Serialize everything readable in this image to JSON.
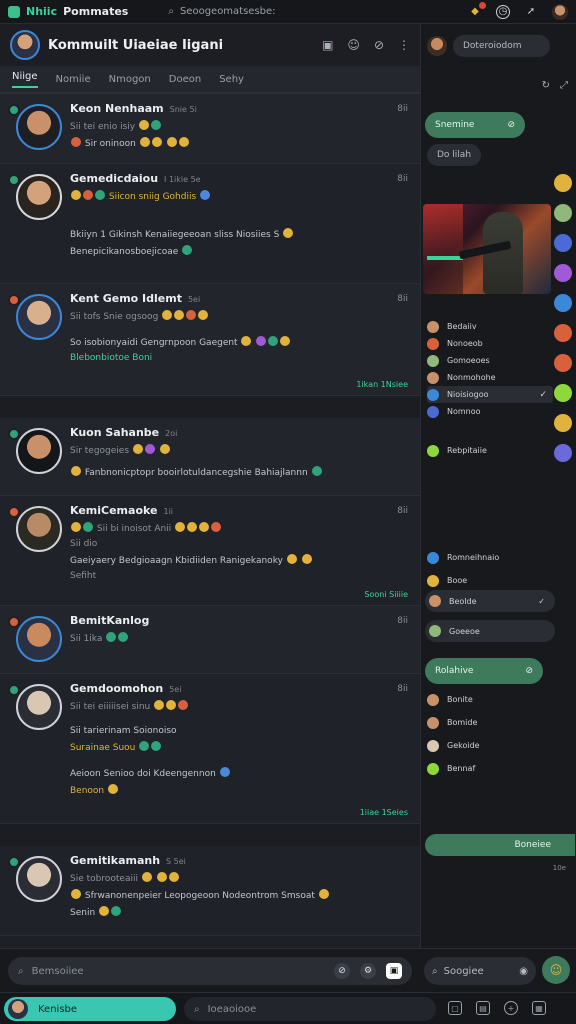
{
  "topbar": {
    "brand_a": "Nhiic",
    "brand_b": "Pommates",
    "search_placeholder": "Seoogeomatsesbe:"
  },
  "channel": {
    "title": "Kommuilt Uiaeiae Iigani",
    "tabs": [
      "Niige",
      "Nomiie",
      "Nmogon",
      "Doeon",
      "Sehy"
    ]
  },
  "messages": [
    {
      "name": "Keon Nenhaam",
      "meta": "Snie 5i",
      "more": "8ii",
      "lines": [
        "Sii tei enio isiy",
        "Sir oninoon"
      ],
      "timestamp": ""
    },
    {
      "name": "Gemedicdaiou",
      "meta": "I 1ikie 5e",
      "more": "8ii",
      "lines": [
        "Siicon sniig Gohdiis",
        "Bkiiyn 1 Gikinsh Kenaiiegeeoan sliss Niosiies S",
        "Benepicikanosboejicoae"
      ],
      "timestamp": ""
    },
    {
      "name": "Kent Gemo Idlemt",
      "meta": "5ei",
      "more": "8ii",
      "lines": [
        "Sii tofs Snie ogsoog",
        "So isobionyaidi Gengrnpoon Gaegent",
        "Blebonbiotoe Boni"
      ],
      "timestamp": "1ikan 1Nsiee"
    },
    {
      "name": "Kuon Sahanbe",
      "meta": "2oi",
      "more": "",
      "lines": [
        "Sir tegogeies",
        "Fanbnonicptopr booirlotuldancegshie Bahiajlannn"
      ],
      "timestamp": ""
    },
    {
      "name": "KemiCemaoke",
      "meta": "1ii",
      "more": "8ii",
      "lines": [
        "Sii bi inoisot Anii",
        "Sii dio",
        "Gaeiyaery Bedgioaagn Kbidiiden Ranigekanoky",
        "Sefiht"
      ],
      "timestamp": "Sooni Siiiie"
    },
    {
      "name": "BemitKanlog",
      "meta": "",
      "more": "8ii",
      "lines": [
        "Sii 1ika"
      ],
      "timestamp": ""
    },
    {
      "name": "Gemdoomohon",
      "meta": "5ei",
      "more": "8ii",
      "lines": [
        "Sii tei eiiiiisei sinu",
        "Sii tarierinam Soionoiso",
        "Surainae Suou",
        "Aeioon Senioo doi Kdeengennon",
        "Benoon"
      ],
      "timestamp": "1iiae 1Seies"
    },
    {
      "name": "Gemitikamanh",
      "meta": "S 5ei",
      "more": "",
      "lines": [
        "Sie tobrooteaiii",
        "Sfrwanonenpeier Leopogeoon Nodeontrom Smsoat",
        "Senin"
      ],
      "timestamp": ""
    }
  ],
  "composer": {
    "placeholder": "Bemsoiiee",
    "right_placeholder": "Soogiee"
  },
  "bottombar": {
    "user_label": "Kenisbe",
    "search_placeholder": "Ioeaoiooe"
  },
  "right": {
    "header_pill": "Doteroiodom",
    "bubble_green_1": "Snemine",
    "bubble_dark_1": "Do lilah",
    "list_a": [
      "Bedaiiv",
      "Nonoeob",
      "Gomoeoes",
      "Nonmohohe",
      "Nioisiogoo",
      "Nomnoo"
    ],
    "reply": "Rebpitaiie",
    "list_b": [
      "Romneihnaio",
      "Booe",
      "Beolde"
    ],
    "pill_sel": "Goeeoe",
    "bubble_green_2": "Rolahive",
    "list_c": [
      "Bonite",
      "Bomide",
      "Gekoide",
      "Bennaf"
    ],
    "bubble_green_3": "Boneiee",
    "time_footer": "10e"
  }
}
